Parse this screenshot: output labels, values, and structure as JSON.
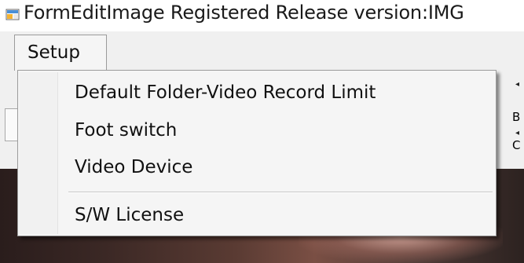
{
  "window": {
    "title": "FormEditImage Registered Release version:IMG",
    "icon": "app-icon"
  },
  "menubar": {
    "setup_label": "Setup"
  },
  "dropdown": {
    "items": [
      {
        "label": "Default Folder-Video Record Limit"
      },
      {
        "label": "Foot switch"
      },
      {
        "label": "Video Device"
      },
      {
        "label": "S/W License"
      }
    ]
  },
  "background": {
    "right_labels": [
      "B",
      "C"
    ]
  },
  "colors": {
    "menu_background": "#f5f5f5",
    "menu_border": "#9c9c9c",
    "window_background": "#f0f0f0"
  }
}
